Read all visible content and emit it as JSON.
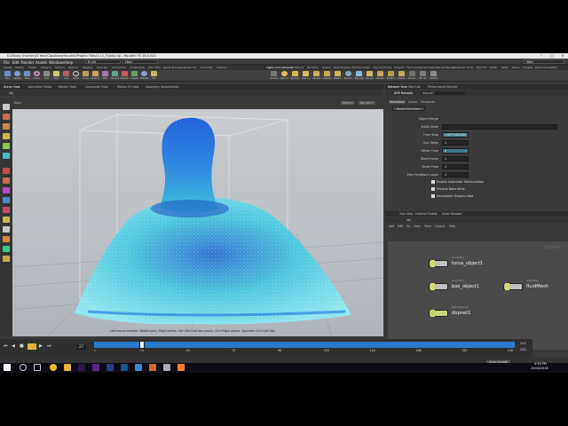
{
  "window": {
    "title": "D:/Study (Hunter)/3 Year/Capstone/Houdini/Project Files/3.12_Fluids.hip - Houdini FX 16.0.621",
    "min": "–",
    "max": "□",
    "close": "✕"
  },
  "menu": {
    "items": [
      "File",
      "Edit",
      "Render",
      "Assets",
      "Windows",
      "Help"
    ],
    "build_label": "Build",
    "desktop_label": "Main"
  },
  "shelf_tabs": [
    "Create",
    "Modify",
    "Model",
    "Polygon",
    "Deform",
    "Texture",
    "Rigging",
    "Muscles",
    "Characters",
    "Constraints",
    "Hair Utils",
    "Guide Process",
    "Terrain FX",
    "Cloud FX",
    "Volume",
    "Lights and Cameras",
    "Collisions",
    "Particles",
    "Grains",
    "Rigid Bodies",
    "Particle Fluids",
    "Viscous Fluids",
    "Oceans",
    "Fluid Containers",
    "Populate Containers",
    "Container Tools",
    "Pyro FX",
    "Cloth",
    "Solid",
    "Wires",
    "Crowds",
    "Drive Simulation"
  ],
  "shelf_tools_left": [
    "Box",
    "Sphere",
    "Tube",
    "Torus",
    "Grid",
    "Null",
    "Line",
    "Circle",
    "Curve",
    "Draw Curve",
    "Path",
    "Spray Paint",
    "Platonic",
    "L-System",
    "Metaball",
    "File"
  ],
  "shelf_tools_right": [
    "Camera",
    "Point Light",
    "Spot Light",
    "Area Light",
    "Geometry Light",
    "Volume Light",
    "Distant Light",
    "Environment Light",
    "Sky Light",
    "GI Light",
    "Caustic Light",
    "Portal Light",
    "Ambient Light",
    "Stereo Camera",
    "VR Camera",
    "Switcher"
  ],
  "pane_tabs_left": [
    "Scene View",
    "Animation Editor",
    "Render View",
    "Composite View",
    "Motion FX View",
    "Geometry Spreadsheet"
  ],
  "viewport": {
    "path": "obj",
    "view_label": "View",
    "persp": "Persp ▾",
    "cam": "No cam ▾",
    "status": "Left mouse tumbles. Middle pans. Right dollies. Ctrl+Alt+Left box zooms. Ctrl+Right zooms. Spacebar Ctrl+Left tilts."
  },
  "right_tabs": [
    "Network View",
    "Take List",
    "Performance Monitor"
  ],
  "params": {
    "node_type": "DOP Network",
    "node_name": "dopnet1",
    "subtabs": [
      "Simulation",
      "Cache",
      "Transform"
    ],
    "reset_button": "Reset Simulation",
    "rows": [
      {
        "label": "Object Merge",
        "value": ""
      },
      {
        "label": "Initial State",
        "value": ""
      },
      {
        "label": "Time Step",
        "value": "1/$FPS/$SUBS"
      },
      {
        "label": "Sub Steps",
        "value": "1"
      },
      {
        "label": "Offset Time",
        "value": "0"
      },
      {
        "label": "Start Frame",
        "value": "1"
      },
      {
        "label": "Scale Time",
        "value": "1"
      },
      {
        "label": "Max Feedback Loops",
        "value": "1"
      }
    ],
    "checks": [
      "Enable Automatic Resimulation",
      "Provide Data Hints",
      "Interpolate Display Data"
    ]
  },
  "network": {
    "tabs": [
      "Tree View",
      "Material Palette",
      "Asset Browser"
    ],
    "path": "obj",
    "menu": [
      "Add",
      "Edit",
      "Go",
      "View",
      "Tools",
      "Layout",
      "Help"
    ],
    "context_label": "Scene",
    "nodes": [
      {
        "type": "Geometry",
        "name": "torus_object1",
        "color": "#d6d96a"
      },
      {
        "type": "Geometry",
        "name": "box_object1",
        "color": "#d6d96a"
      },
      {
        "type": "Geometry",
        "name": "fluidMesh",
        "color": "#d6d96a"
      },
      {
        "type": "DOP Network",
        "name": "dopnet1",
        "color": "#b8d36a"
      }
    ]
  },
  "timeline": {
    "current_frame": "27",
    "ticks": [
      "1",
      "24",
      "48",
      "72",
      "96",
      "120",
      "144",
      "168",
      "192",
      "216"
    ],
    "end_frame": "240",
    "start": "1",
    "end": "240",
    "playhead_fraction": 0.108
  },
  "statusbar": {
    "auto_update": "Auto Update"
  },
  "taskbar": {
    "time": "4:56 PM",
    "date": "25/04/2018",
    "icons": [
      "windows-icon",
      "search-icon",
      "task-view-icon",
      "chrome-icon",
      "explorer-icon",
      "premiere-icon",
      "aftereffects-icon",
      "vlc-icon",
      "steam-icon",
      "store-icon",
      "houdini-icon",
      "notes-icon",
      "houdini-active-icon"
    ]
  }
}
